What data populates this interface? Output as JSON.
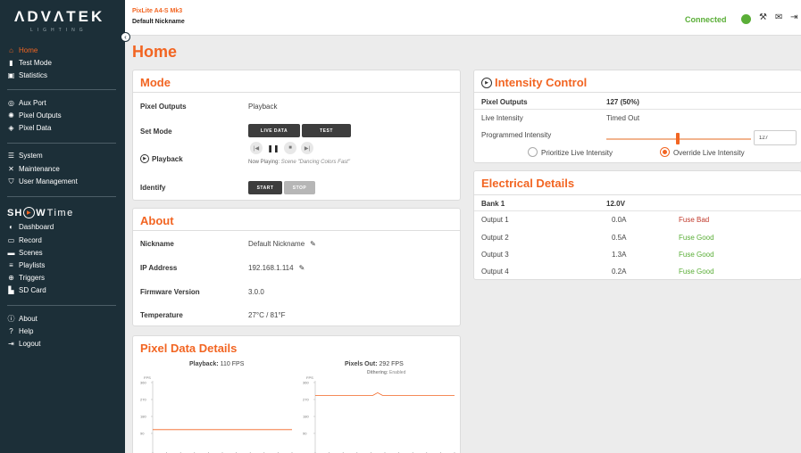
{
  "sidebar": {
    "logo_main": "ΛDVΛTEK",
    "logo_sub": "LIGHTING",
    "items": [
      {
        "label": "Home",
        "icon": "home-icon"
      },
      {
        "label": "Test Mode",
        "icon": "flask-icon"
      },
      {
        "label": "Statistics",
        "icon": "statistics-icon"
      },
      {
        "label": "Aux Port",
        "icon": "aux-port-icon"
      },
      {
        "label": "Pixel Outputs",
        "icon": "pixel-outputs-icon"
      },
      {
        "label": "Pixel Data",
        "icon": "pixel-data-icon"
      },
      {
        "label": "System",
        "icon": "sliders-icon"
      },
      {
        "label": "Maintenance",
        "icon": "tools-icon"
      },
      {
        "label": "User Management",
        "icon": "user-shield-icon"
      },
      {
        "label": "Dashboard",
        "icon": "dashboard-icon"
      },
      {
        "label": "Record",
        "icon": "record-icon"
      },
      {
        "label": "Scenes",
        "icon": "scenes-icon"
      },
      {
        "label": "Playlists",
        "icon": "playlist-icon"
      },
      {
        "label": "Triggers",
        "icon": "trigger-icon"
      },
      {
        "label": "SD Card",
        "icon": "sd-card-icon"
      },
      {
        "label": "About",
        "icon": "info-icon"
      },
      {
        "label": "Help",
        "icon": "help-icon"
      },
      {
        "label": "Logout",
        "icon": "logout-icon"
      }
    ],
    "showtime": {
      "sh": "SH",
      "w": "W",
      "time": "Time"
    }
  },
  "header": {
    "device_model": "PixLite A4-S Mk3",
    "device_nickname": "Default Nickname",
    "status": "Connected",
    "status_color": "#5aae37"
  },
  "page_title": "Home",
  "mode": {
    "title": "Mode",
    "pixel_outputs_label": "Pixel Outputs",
    "pixel_outputs_value": "Playback",
    "set_mode_label": "Set Mode",
    "live_data_button": "LIVE DATA",
    "test_button": "TEST",
    "playback_label": "Playback",
    "now_playing_prefix": "Now Playing:",
    "now_playing_scene": "Scene \"Dancing Colors Fast\"",
    "identify_label": "Identify",
    "start_button": "START",
    "stop_button": "STOP"
  },
  "about": {
    "title": "About",
    "rows": [
      {
        "label": "Nickname",
        "value": "Default Nickname",
        "editable": true
      },
      {
        "label": "IP Address",
        "value": "192.168.1.114",
        "editable": true
      },
      {
        "label": "Firmware Version",
        "value": "3.0.0",
        "editable": false
      },
      {
        "label": "Temperature",
        "value": "27°C / 81°F",
        "editable": false
      }
    ]
  },
  "pixel_data": {
    "title": "Pixel Data Details",
    "playback_label": "Playback:",
    "playback_value": "110 FPS",
    "pixels_out_label": "Pixels Out:",
    "pixels_out_value": "292 FPS",
    "dithering_label": "Dithering:",
    "dithering_value": "Enabled"
  },
  "intensity": {
    "title": "Intensity Control",
    "header_label": "Pixel Outputs",
    "header_value": "127 (50%)",
    "live_label": "Live Intensity",
    "live_value": "Timed Out",
    "programmed_label": "Programmed Intensity",
    "programmed_value": "127",
    "programmed_fraction": 0.5,
    "radio_prioritize": "Prioritize Live Intensity",
    "radio_override": "Override Live Intensity",
    "selected_option": "Override Live Intensity"
  },
  "electrical": {
    "title": "Electrical Details",
    "bank_label": "Bank 1",
    "bank_voltage": "12.0V",
    "outputs": [
      {
        "name": "Output 1",
        "current": "0.0A",
        "status": "Fuse Bad",
        "status_color": "#c0392b"
      },
      {
        "name": "Output 2",
        "current": "0.5A",
        "status": "Fuse Good",
        "status_color": "#5aae37"
      },
      {
        "name": "Output 3",
        "current": "1.3A",
        "status": "Fuse Good",
        "status_color": "#5aae37"
      },
      {
        "name": "Output 4",
        "current": "0.2A",
        "status": "Fuse Good",
        "status_color": "#5aae37"
      }
    ]
  },
  "accent_color": "#f26522",
  "chart_data": [
    {
      "type": "line",
      "unit_label": "FPS",
      "y_ticks": [
        "360",
        "270",
        "180",
        "90"
      ],
      "ylim": [
        0,
        360
      ],
      "x": [
        0,
        1,
        2,
        3,
        4,
        5,
        6,
        7,
        8,
        9,
        10,
        11,
        12,
        13,
        14,
        15,
        16,
        17,
        18,
        19,
        20,
        21,
        22,
        23,
        24,
        25,
        26,
        27,
        28,
        29
      ],
      "series": [
        {
          "values": [
            110,
            110,
            110,
            110,
            110,
            110,
            110,
            110,
            110,
            110,
            110,
            110,
            110,
            110,
            110,
            110,
            110,
            110,
            110,
            110,
            110,
            110,
            110,
            110,
            110,
            110,
            110,
            110,
            110,
            110
          ]
        }
      ]
    },
    {
      "type": "line",
      "unit_label": "FPS",
      "y_ticks": [
        "360",
        "270",
        "180",
        "90"
      ],
      "ylim": [
        0,
        360
      ],
      "x": [
        0,
        1,
        2,
        3,
        4,
        5,
        6,
        7,
        8,
        9,
        10,
        11,
        12,
        13,
        14,
        15,
        16,
        17,
        18,
        19,
        20,
        21,
        22,
        23,
        24,
        25,
        26,
        27,
        28,
        29
      ],
      "series": [
        {
          "values": [
            292,
            292,
            292,
            292,
            292,
            292,
            292,
            292,
            292,
            292,
            292,
            292,
            292,
            306,
            292,
            292,
            292,
            292,
            292,
            292,
            292,
            292,
            292,
            292,
            292,
            292,
            292,
            292,
            292,
            292
          ]
        }
      ]
    }
  ]
}
